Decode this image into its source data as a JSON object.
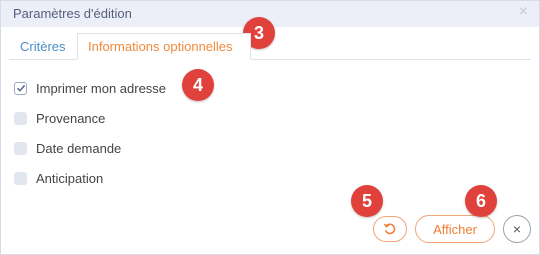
{
  "dialog": {
    "title": "Paramètres d'édition",
    "close_glyph": "×"
  },
  "tabs": [
    {
      "label": "Critères",
      "active": false
    },
    {
      "label": "Informations optionnelles",
      "active": true
    }
  ],
  "options": [
    {
      "label": "Imprimer mon adresse",
      "checked": true
    },
    {
      "label": "Provenance",
      "checked": false
    },
    {
      "label": "Date demande",
      "checked": false
    },
    {
      "label": "Anticipation",
      "checked": false
    }
  ],
  "buttons": {
    "reset_icon": "refresh-icon",
    "afficher_label": "Afficher",
    "close_glyph": "×"
  },
  "badges": [
    "3",
    "4",
    "5",
    "6"
  ],
  "colors": {
    "accent_orange": "#ee7e33",
    "tab_blue": "#4b8ec7",
    "badge_red": "#e1413b",
    "titlebar_bg": "#eceff8"
  }
}
